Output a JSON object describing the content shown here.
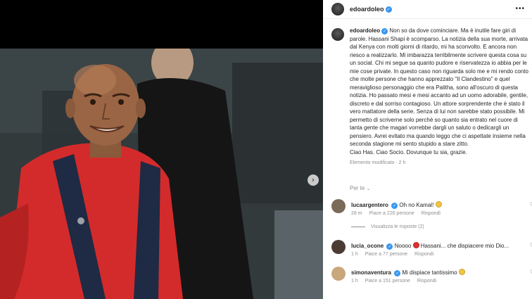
{
  "post": {
    "username": "edoardoleo",
    "caption": "Non so da dove cominciare. Ma è inutile fare giri di parole. Hassani Shapi è scomparso. La notizia della sua morte, arrivata dal Kenya con molti giorni di ritardo, mi ha sconvolto. E ancora non riesco a realizzarlo. Mi imbarazza terribilmente scrivere questa cosa su un social. Chi mi segue sa quanto pudore e riservatezza io abbia per le mie cose private. In questo caso non riguarda solo me e mi rendo conto che molte persone che hanno apprezzato \"Il Clandestino\" e quel meraviglioso personaggio che era Palitha, sono all'oscuro di questa notizia. Ho passato mesi e mesi accanto ad un uomo adorabile, gentile, discreto e dal sorriso contagioso. Un attore sorprendente che è stato il vero mattatore della serie. Senza di lui non sarebbe stato possibile. Mi permetto di scriverne solo perché so quanto sia entrato nel cuore di tanta gente che magari vorrebbe dargli un saluto o dedicargli un pensiero. Avrei evitato ma quando leggo che ci aspettate insieme nella seconda stagione mi sento stupido a stare zitto.",
    "caption_end": "Ciao Has. Ciao Socio. Dovunque tu sia, grazie.",
    "meta": "Elemento modificato · 2 h",
    "more_icon": "more-horizontal-icon"
  },
  "separator": "Per te",
  "comments": [
    {
      "username": "lucaargentero",
      "text": "Oh no Kamal!",
      "emoji": "sad-face-emoji",
      "time": "28 m",
      "likes": "Piace a 226 persone",
      "reply": "Rispondi",
      "avatar_color": "#7a6a58"
    },
    {
      "username": "lucia_ocone",
      "text": "Noooo",
      "text_after": "Hassani... che dispiacere mio Dio...",
      "emoji": "red-heart-emoji",
      "time": "1 h",
      "likes": "Piace a 77 persone",
      "reply": "Rispondi",
      "avatar_color": "#4a3b33"
    },
    {
      "username": "simonaventura",
      "text": "Mi dispiace tantissimo",
      "emoji": "sad-face-emoji",
      "time": "1 h",
      "likes": "Piace a 151 persone",
      "reply": "Rispondi",
      "avatar_color": "#c9a77c"
    }
  ],
  "view_replies": "Visualizza le risposte (2)",
  "media": {
    "next_icon": "chevron-right-icon"
  }
}
